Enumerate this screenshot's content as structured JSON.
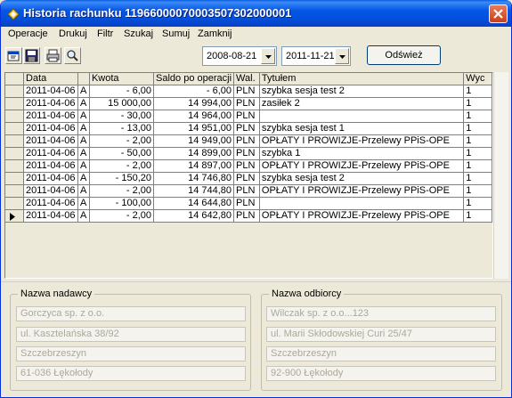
{
  "window": {
    "title": "Historia rachunku 11966000070003507302000001"
  },
  "menu": {
    "items": [
      "Operacje",
      "Drukuj",
      "Filtr",
      "Szukaj",
      "Sumuj",
      "Zamknij"
    ]
  },
  "toolbar": {
    "icons": [
      "properties-icon",
      "save-icon",
      "print-icon",
      "search-icon"
    ]
  },
  "filter": {
    "date_from": "2008-08-21",
    "date_to": "2011-11-21",
    "refresh_label": "Odśwież"
  },
  "table": {
    "columns": [
      "Data",
      "Kwota",
      "Saldo po operacji",
      "Wal.",
      "Tytułem",
      "Wyc"
    ],
    "rows": [
      {
        "date": "2011-04-06",
        "type": "A",
        "amount": "- 6,00",
        "balance": "- 6,00",
        "currency": "PLN",
        "title": "szybka sesja  test 2",
        "wyc": "1",
        "current": false
      },
      {
        "date": "2011-04-06",
        "type": "A",
        "amount": "15 000,00",
        "balance": "14 994,00",
        "currency": "PLN",
        "title": "zasiłek 2",
        "wyc": "1",
        "current": false
      },
      {
        "date": "2011-04-06",
        "type": "A",
        "amount": "- 30,00",
        "balance": "14 964,00",
        "currency": "PLN",
        "title": "",
        "wyc": "1",
        "current": false
      },
      {
        "date": "2011-04-06",
        "type": "A",
        "amount": "- 13,00",
        "balance": "14 951,00",
        "currency": "PLN",
        "title": "szybka sesja  test 1",
        "wyc": "1",
        "current": false
      },
      {
        "date": "2011-04-06",
        "type": "A",
        "amount": "- 2,00",
        "balance": "14 949,00",
        "currency": "PLN",
        "title": "OPŁATY I PROWIZJE-Przelewy PPiS-OPE",
        "wyc": "1",
        "current": false
      },
      {
        "date": "2011-04-06",
        "type": "A",
        "amount": "- 50,00",
        "balance": "14 899,00",
        "currency": "PLN",
        "title": "szybka 1",
        "wyc": "1",
        "current": false
      },
      {
        "date": "2011-04-06",
        "type": "A",
        "amount": "- 2,00",
        "balance": "14 897,00",
        "currency": "PLN",
        "title": "OPŁATY I PROWIZJE-Przelewy PPiS-OPE",
        "wyc": "1",
        "current": false
      },
      {
        "date": "2011-04-06",
        "type": "A",
        "amount": "- 150,20",
        "balance": "14 746,80",
        "currency": "PLN",
        "title": "szybka sesja  test 2",
        "wyc": "1",
        "current": false
      },
      {
        "date": "2011-04-06",
        "type": "A",
        "amount": "- 2,00",
        "balance": "14 744,80",
        "currency": "PLN",
        "title": "OPŁATY I PROWIZJE-Przelewy PPiS-OPE",
        "wyc": "1",
        "current": false
      },
      {
        "date": "2011-04-06",
        "type": "A",
        "amount": "- 100,00",
        "balance": "14 644,80",
        "currency": "PLN",
        "title": "",
        "wyc": "1",
        "current": false
      },
      {
        "date": "2011-04-06",
        "type": "A",
        "amount": "- 2,00",
        "balance": "14 642,80",
        "currency": "PLN",
        "title": "OPŁATY I PROWIZJE-Przelewy PPiS-OPE",
        "wyc": "1",
        "current": true
      }
    ]
  },
  "sender": {
    "legend": "Nazwa nadawcy",
    "lines": [
      "Gorczyca sp. z o.o.",
      "ul. Kasztelańska 38/92",
      "Szczebrzeszyn",
      "61-036 Łękołody"
    ]
  },
  "recipient": {
    "legend": "Nazwa odbiorcy",
    "lines": [
      "Wilczak sp. z o.o...123",
      "ul. Marii Skłodowskiej Curi 25/47",
      "Szczebrzeszyn",
      "92-900 Łękołody"
    ]
  },
  "colors": {
    "titlebar": "#0456e6",
    "window_bg": "#ece9d8",
    "close_button": "#c5401c"
  }
}
